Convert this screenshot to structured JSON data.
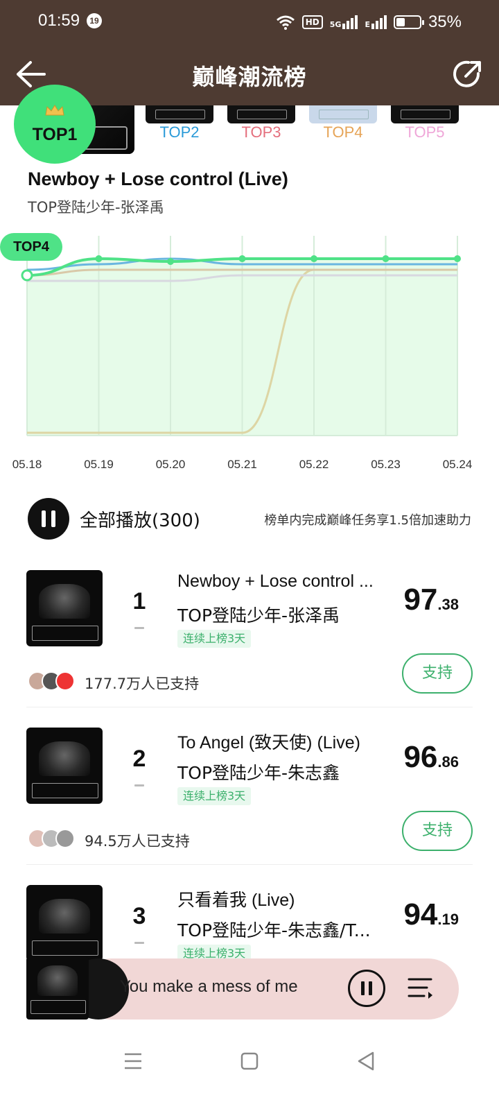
{
  "status_bar": {
    "time": "01:59",
    "notification_count": "19",
    "network_hd": "HD",
    "network_5g": "5G",
    "network_e": "E",
    "battery_percent": "35%",
    "battery_level": 0.35
  },
  "header": {
    "title": "巅峰潮流榜",
    "back_icon": "back-arrow-icon",
    "share_icon": "share-icon"
  },
  "top_ranks": {
    "top1": "TOP1",
    "items": [
      {
        "label": "TOP2",
        "color": "#2a9ad8"
      },
      {
        "label": "TOP3",
        "color": "#e46e7c"
      },
      {
        "label": "TOP4",
        "color": "#e6a457"
      },
      {
        "label": "TOP5",
        "color": "#efa6d8"
      }
    ]
  },
  "selected_song": {
    "title": "Newboy + Lose control (Live)",
    "artist": "TOP登陆少年-张泽禹"
  },
  "chart_data": {
    "type": "line",
    "current_rank_badge": "TOP4",
    "x": [
      "05.18",
      "05.19",
      "05.20",
      "05.21",
      "05.22",
      "05.23",
      "05.24"
    ],
    "y_axis": "rank (1 = top)",
    "series": [
      {
        "color": "#4fe287",
        "values": [
          4,
          1,
          1.5,
          1,
          1,
          1,
          1
        ]
      },
      {
        "color": "#6ab6e0",
        "values": [
          3,
          2,
          1,
          2,
          2,
          2,
          2
        ]
      },
      {
        "color": "#d9c9a8",
        "values": [
          4,
          3,
          3,
          3,
          3,
          3,
          3
        ]
      },
      {
        "color": "#d8d8e0",
        "values": [
          5,
          5,
          5,
          4,
          4,
          4,
          4
        ]
      },
      {
        "color": "#ddd5a4",
        "values": [
          30,
          30,
          30,
          30,
          3,
          3,
          3
        ]
      }
    ],
    "grid": true
  },
  "play_all": {
    "label": "全部播放(300)",
    "note": "榜单内完成巅峰任务享1.5倍加速助力"
  },
  "songs": [
    {
      "rank": "1",
      "title": "Newboy + Lose control ...",
      "artist": "TOP登陆少年-张泽禹",
      "tag": "连续上榜3天",
      "score_int": "97",
      "score_dec": ".38",
      "supporters": "177.7万人已支持",
      "support_btn": "支持"
    },
    {
      "rank": "2",
      "title": "To Angel (致天使) (Live)",
      "artist": "TOP登陆少年-朱志鑫",
      "tag": "连续上榜3天",
      "score_int": "96",
      "score_dec": ".86",
      "supporters": "94.5万人已支持",
      "support_btn": "支持"
    },
    {
      "rank": "3",
      "title": "只看着我 (Live)",
      "artist": "TOP登陆少年-朱志鑫/T...",
      "tag": "连续上榜3天",
      "score_int": "94",
      "score_dec": ".19"
    }
  ],
  "player": {
    "title": "You make a mess of me"
  },
  "nav": {
    "menu_icon": "menu-icon",
    "home_icon": "home-square-icon",
    "back_icon": "back-triangle-icon"
  }
}
